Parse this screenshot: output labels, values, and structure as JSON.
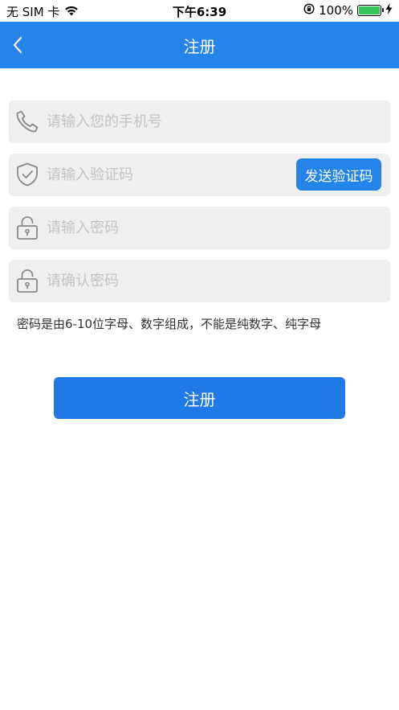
{
  "status_bar": {
    "carrier": "无 SIM 卡",
    "time": "下午6:39",
    "battery": "100%",
    "battery_color": "#34c759"
  },
  "navbar": {
    "title": "注册",
    "back_icon": "chevron-left-icon",
    "color": "#2484ea"
  },
  "form": {
    "phone": {
      "placeholder": "请输入您的手机号",
      "value": "",
      "icon": "phone-icon"
    },
    "code": {
      "placeholder": "请输入验证码",
      "value": "",
      "icon": "shield-check-icon",
      "send_label": "发送验证码"
    },
    "password": {
      "placeholder": "请输入密码",
      "value": "",
      "icon": "lock-icon"
    },
    "confirm": {
      "placeholder": "请确认密码",
      "value": "",
      "icon": "lock-icon"
    },
    "hint": "密码是由6-10位字母、数字组成，不能是纯数字、纯字母",
    "submit_label": "注册"
  }
}
